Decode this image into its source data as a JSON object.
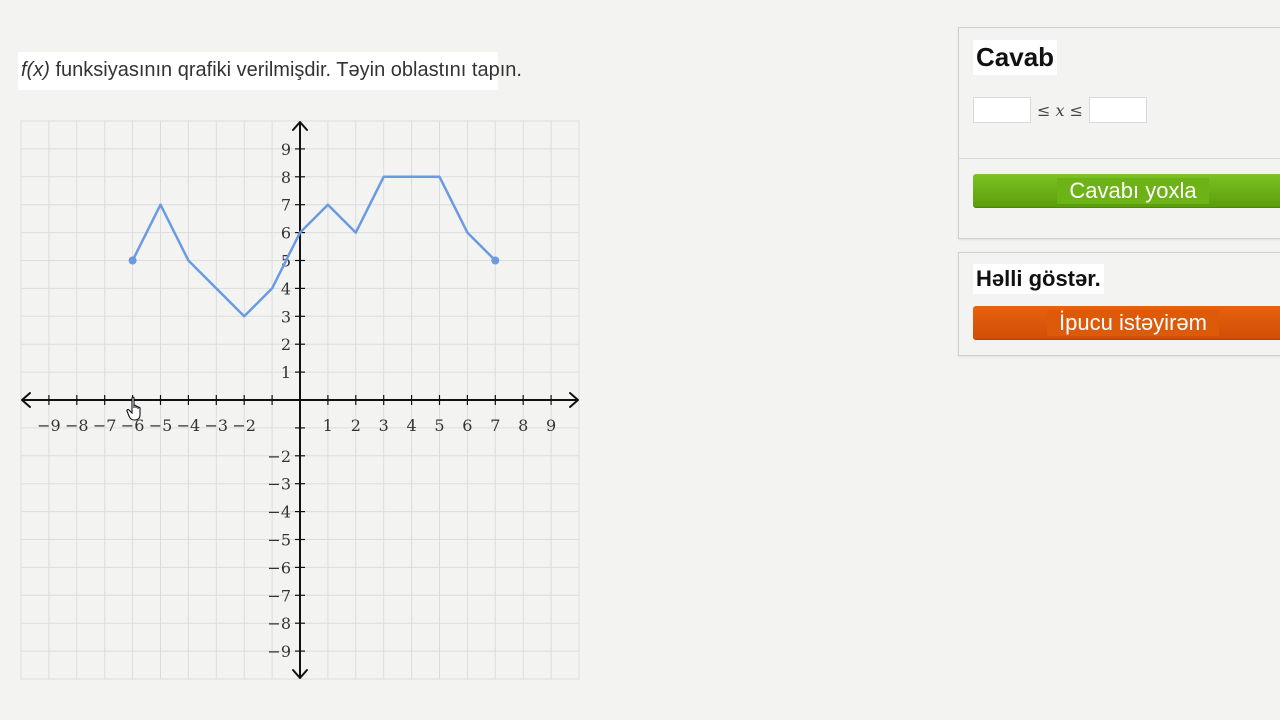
{
  "question": {
    "func": "f(x)",
    "text": " funksiyasının qrafiki verilmişdir. Təyin oblastını tapın."
  },
  "graph": {
    "x_range": [
      -9,
      9
    ],
    "y_range": [
      -9,
      9
    ],
    "x_ticks": [
      "−9",
      "−8",
      "−7",
      "−6",
      "−5",
      "−4",
      "−3",
      "−2",
      "1",
      "2",
      "3",
      "4",
      "5",
      "6",
      "7",
      "8",
      "9"
    ],
    "y_ticks_pos": [
      "1",
      "2",
      "3",
      "4",
      "5",
      "6",
      "7",
      "8",
      "9"
    ],
    "y_ticks_neg": [
      "−2",
      "−3",
      "−4",
      "−5",
      "−6",
      "−7",
      "−8",
      "−9"
    ],
    "grid_color": "#dcdcdc",
    "axis_color": "#111111",
    "line_color": "#6b9ae0",
    "points": [
      [
        -6,
        5
      ],
      [
        -5,
        7
      ],
      [
        -4,
        5
      ],
      [
        -2,
        3
      ],
      [
        -1,
        4
      ],
      [
        0,
        6
      ],
      [
        1,
        7
      ],
      [
        2,
        6
      ],
      [
        3,
        8
      ],
      [
        5,
        8
      ],
      [
        6,
        6
      ],
      [
        7,
        5
      ]
    ],
    "endpoints": [
      [
        -6,
        5
      ],
      [
        7,
        5
      ]
    ]
  },
  "answer": {
    "title": "Cavab",
    "relation_left": "≤",
    "relation_var": "x",
    "relation_right": "≤",
    "lower_value": "",
    "upper_value": "",
    "check_label": "Cavabı yoxla",
    "check_color": "#6db318"
  },
  "hint": {
    "title": "Həlli göstər.",
    "button_label": "İpucu istəyirəm",
    "button_color": "#dd5a0a"
  },
  "cursor_icon": "hand-pointer-icon"
}
